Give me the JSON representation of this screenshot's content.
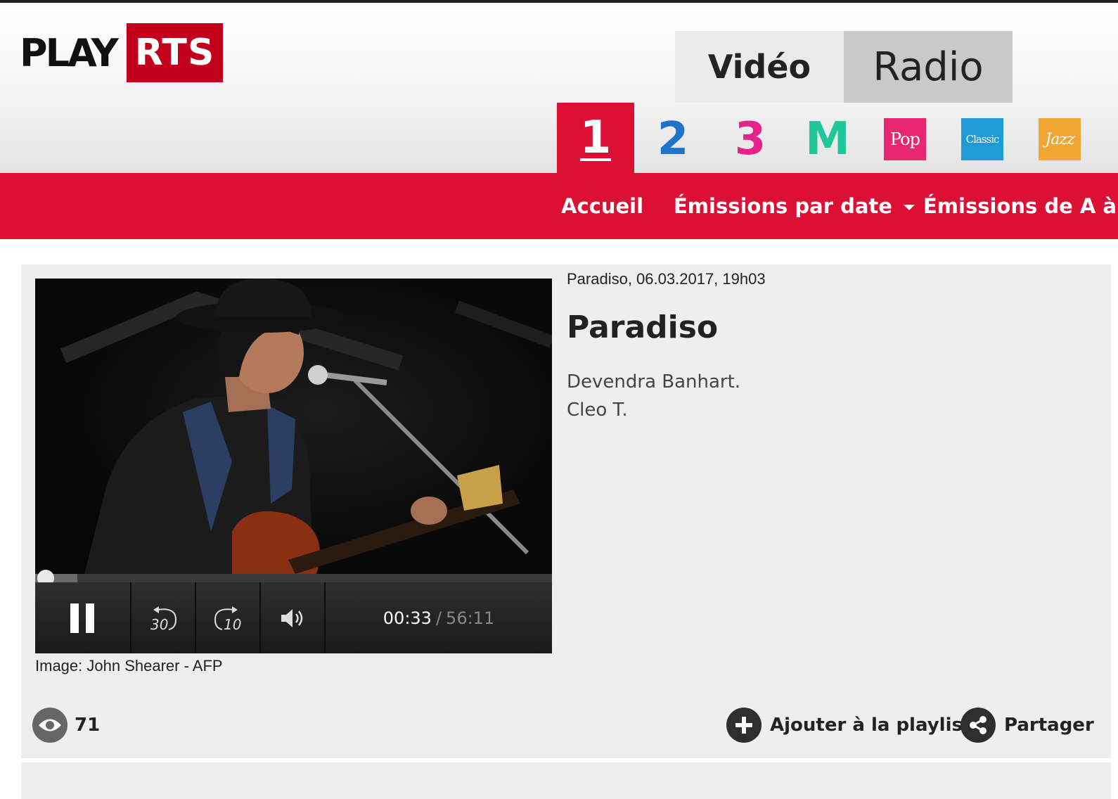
{
  "logo": {
    "play": "PLAY",
    "brand": "RTS"
  },
  "mode_tabs": {
    "video": "Vidéo",
    "radio": "Radio"
  },
  "stations": [
    {
      "label": "1",
      "icon": "la-1ere-logo"
    },
    {
      "label": "2",
      "icon": "espace-2-logo"
    },
    {
      "label": "3",
      "icon": "couleur-3-logo"
    },
    {
      "label": "M",
      "icon": "option-musique-logo"
    },
    {
      "label": "Pop",
      "icon": "rts-pop-logo"
    },
    {
      "label": "Classic",
      "icon": "rts-classic-logo"
    },
    {
      "label": "Jazz",
      "icon": "rts-jazz-logo"
    }
  ],
  "nav": {
    "home": "Accueil",
    "by_date": "Émissions par date",
    "a_to_z": "Émissions de A à Z"
  },
  "player": {
    "current_time": "00:33",
    "separator": "/",
    "total_time": "56:11",
    "progress_fraction": 0.0098,
    "rewind_label": "30",
    "forward_label": "10",
    "image_credit": "Image: John Shearer - AFP"
  },
  "episode": {
    "meta": "Paradiso, 06.03.2017, 19h03",
    "title": "Paradiso",
    "description_lines": [
      "Devendra Banhart.",
      "Cleo T."
    ]
  },
  "stats": {
    "views": "71"
  },
  "actions": {
    "playlist": "Ajouter à la playlist",
    "share": "Partager"
  },
  "colors": {
    "brand_red": "#dc0f34",
    "logo_red": "#c3001c"
  }
}
